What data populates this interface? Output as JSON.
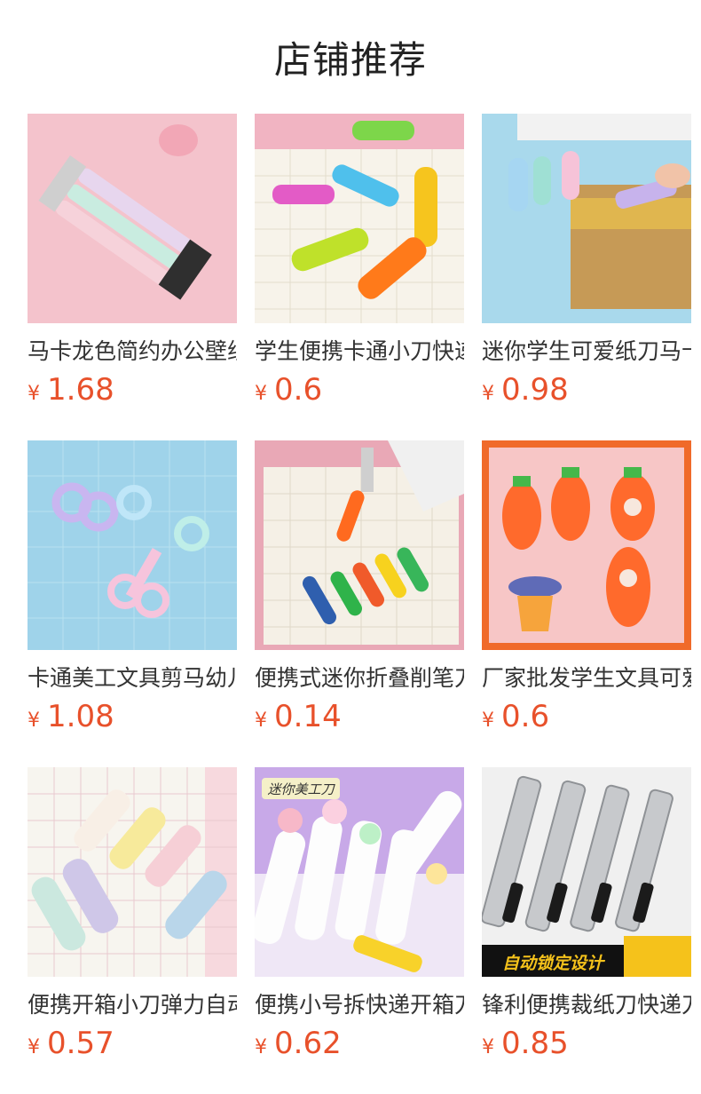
{
  "page": {
    "title": "店铺推荐"
  },
  "colors": {
    "price": "#e8512b",
    "text": "#333333"
  },
  "products": [
    {
      "name": "马卡龙色简约办公壁纸刀",
      "currency": "¥",
      "price": "1.68",
      "image_label": "",
      "image_icon": "utility-knives-pastel-icon"
    },
    {
      "name": "学生便携卡通小刀快递",
      "currency": "¥",
      "price": "0.6",
      "image_label": "",
      "image_icon": "colorful-mini-knives-icon"
    },
    {
      "name": "迷你学生可爱纸刀马卡龙",
      "currency": "¥",
      "price": "0.98",
      "image_label": "",
      "image_icon": "box-cutter-icon"
    },
    {
      "name": "卡通美工文具剪马幼儿园",
      "currency": "¥",
      "price": "1.08",
      "image_label": "",
      "image_icon": "kids-scissors-icon"
    },
    {
      "name": "便携式迷你折叠削笔刀",
      "currency": "¥",
      "price": "0.14",
      "image_label": "",
      "image_icon": "folding-knife-icon"
    },
    {
      "name": "厂家批发学生文具可爱",
      "currency": "¥",
      "price": "0.6",
      "image_label": "",
      "image_icon": "carrot-knife-icon"
    },
    {
      "name": "便携开箱小刀弹力自动",
      "currency": "¥",
      "price": "0.57",
      "image_label": "",
      "image_icon": "mini-box-cutters-icon"
    },
    {
      "name": "便携小号拆快递开箱刀",
      "currency": "¥",
      "price": "0.62",
      "image_label": "迷你美工刀",
      "image_icon": "cartoon-cutters-icon"
    },
    {
      "name": "锋利便携裁纸刀快递刀",
      "currency": "¥",
      "price": "0.85",
      "image_label": "自动锁定设计",
      "image_icon": "metal-cutters-icon"
    }
  ]
}
